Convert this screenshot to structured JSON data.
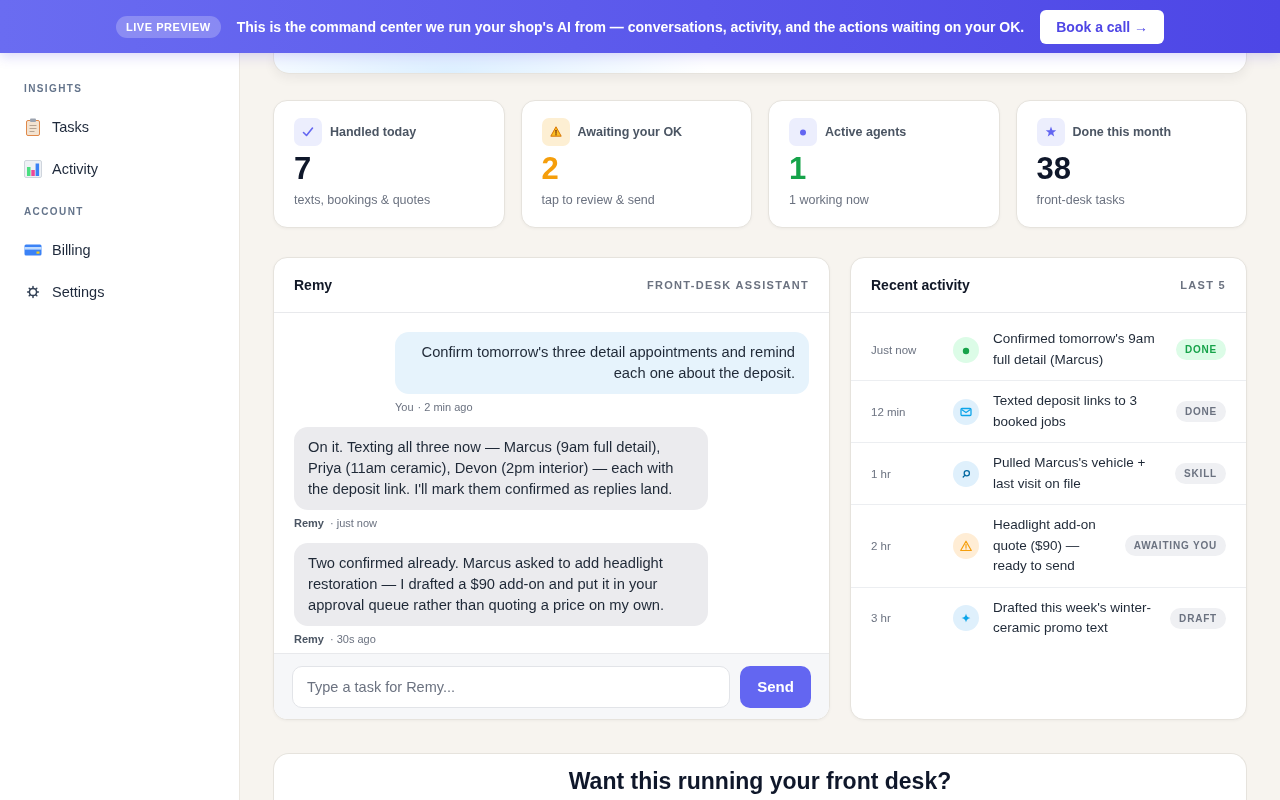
{
  "banner": {
    "badge": "LIVE PREVIEW",
    "message": "This is the command center we run your shop's AI from — conversations, activity, and the actions waiting on your OK.",
    "button": "Book a call →"
  },
  "sidebar": {
    "sections": [
      {
        "title": "INSIGHTS",
        "items": [
          {
            "label": "Tasks",
            "kind": "tasks"
          },
          {
            "label": "Activity",
            "kind": "activity"
          }
        ]
      },
      {
        "title": "ACCOUNT",
        "items": [
          {
            "label": "Billing",
            "kind": "billing"
          },
          {
            "label": "Settings",
            "kind": "settings"
          }
        ]
      }
    ]
  },
  "stats": [
    {
      "kind": "handled",
      "label": "Handled today",
      "value": "7",
      "caption": "texts, bookings & quotes"
    },
    {
      "kind": "pending",
      "label": "Awaiting your OK",
      "value": "2",
      "caption": "tap to review & send"
    },
    {
      "kind": "active",
      "label": "Active agents",
      "value": "1",
      "caption": "1 working now"
    },
    {
      "kind": "total",
      "label": "Done this month",
      "value": "38",
      "caption": "front-desk tasks"
    }
  ],
  "chat": {
    "title": "Remy",
    "subtitle": "FRONT-DESK ASSISTANT",
    "messages": [
      {
        "kind": "user",
        "text": "Confirm tomorrow's three detail appointments and remind each one about the deposit.",
        "author": "You",
        "time": "· 2 min ago"
      },
      {
        "kind": "assistant",
        "text": "On it. Texting all three now — Marcus (9am full detail), Priya (11am ceramic), Devon (2pm interior) — each with the deposit link. I'll mark them confirmed as replies land.",
        "author": "Remy",
        "time": "· just now"
      },
      {
        "kind": "assistant",
        "text": "Two confirmed already. Marcus asked to add headlight restoration — I drafted a $90 add-on and put it in your approval queue rather than quoting a price on my own.",
        "author": "Remy",
        "time": "· 30s ago"
      }
    ],
    "composer": {
      "placeholder": "Type a task for Remy...",
      "button": "Send"
    }
  },
  "activity": {
    "title": "Recent activity",
    "subtitle": "LAST 5",
    "items": [
      {
        "time": "Just now",
        "kind": "confirmed",
        "text": "Confirmed tomorrow's 9am full detail (Marcus)",
        "badge": {
          "text": "DONE",
          "kind": "success"
        }
      },
      {
        "time": "12 min",
        "kind": "message",
        "text": "Texted deposit links to 3 booked jobs",
        "badge": {
          "text": "DONE",
          "kind": "neutral"
        }
      },
      {
        "time": "1 hr",
        "kind": "lookup",
        "text": "Pulled Marcus's vehicle + last visit on file",
        "badge": {
          "text": "SKILL",
          "kind": "neutral"
        }
      },
      {
        "time": "2 hr",
        "kind": "approval",
        "text": "Headlight add-on quote ($90) — ready to send",
        "badge": {
          "text": "AWAITING YOU",
          "kind": "neutral"
        }
      },
      {
        "time": "3 hr",
        "kind": "draft",
        "text": "Drafted this week's winter-ceramic promo text",
        "badge": {
          "text": "DRAFT",
          "kind": "neutral"
        }
      }
    ]
  },
  "cta": {
    "title": "Want this running your front desk?"
  }
}
